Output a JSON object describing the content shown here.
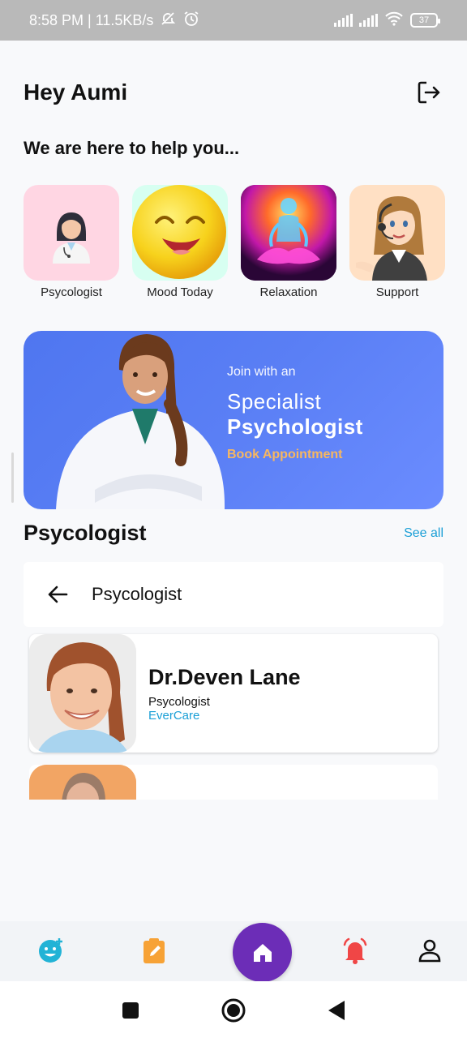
{
  "status_bar": {
    "time_speed": "8:58 PM | 11.5KB/s",
    "battery": "37"
  },
  "header": {
    "greeting": "Hey Aumi",
    "logout_icon": "logout-icon"
  },
  "subtitle": "We are here to help you...",
  "categories": [
    {
      "label": "Psycologist",
      "icon": "doctor-icon",
      "bg": "#ffd6e3"
    },
    {
      "label": "Mood Today",
      "icon": "smiley-icon",
      "bg": "#d7fff1"
    },
    {
      "label": "Relaxation",
      "icon": "meditation-icon",
      "bg": "#3a0a4a"
    },
    {
      "label": "Support",
      "icon": "support-agent-icon",
      "bg": "#ffe0c4"
    }
  ],
  "banner": {
    "line1": "Join with an",
    "line2": "Specialist",
    "line3": "Psychologist",
    "cta": "Book Appointment"
  },
  "section": {
    "title": "Psycologist",
    "see_all": "See all"
  },
  "search": {
    "query": "Psycologist"
  },
  "doctors": [
    {
      "name": "Dr.Deven Lane",
      "role": "Psycologist",
      "org": "EverCare"
    }
  ],
  "bottom_nav": [
    "mood-face-icon",
    "notes-icon",
    "home-icon",
    "alarm-bell-icon",
    "profile-icon"
  ],
  "colors": {
    "accent": "#6c2db7",
    "link": "#1a9fd6",
    "banner": "#5a7ff5",
    "cta": "#f7b760"
  }
}
